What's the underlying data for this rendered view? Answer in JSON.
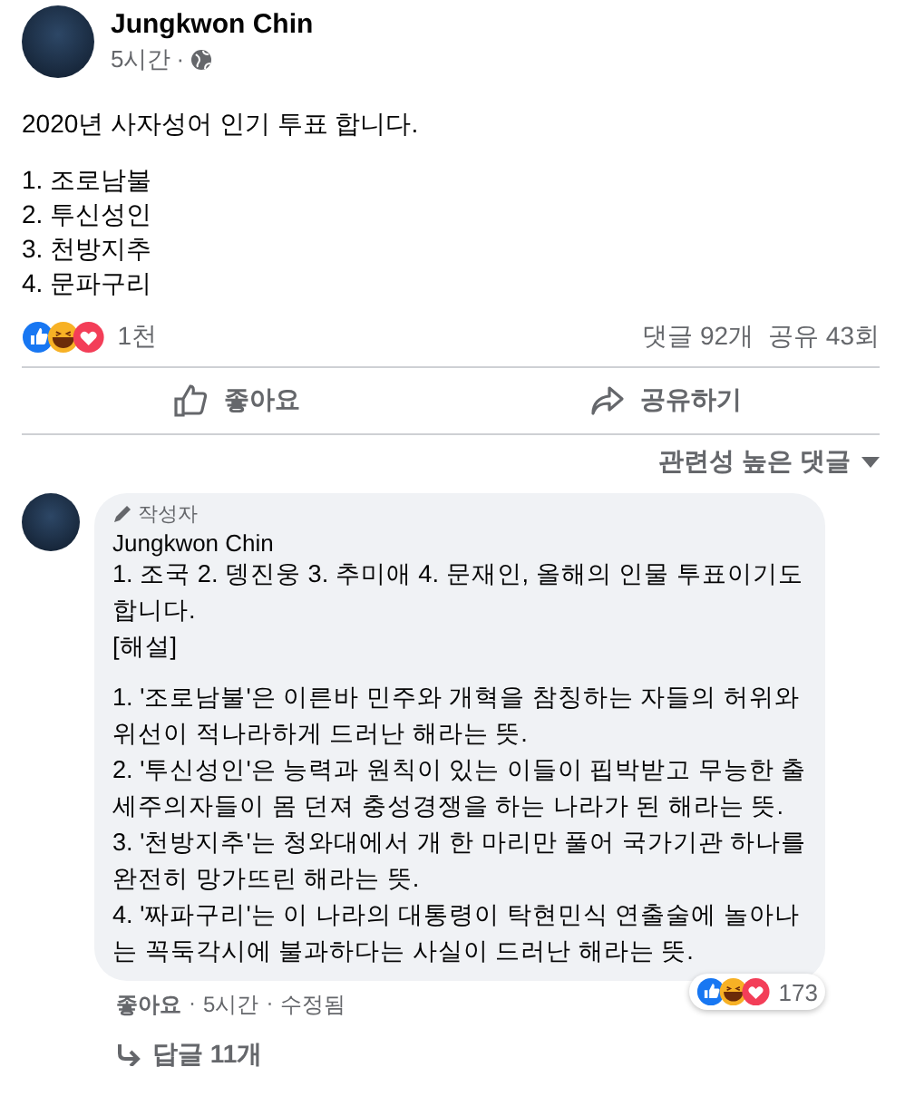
{
  "post": {
    "author": "Jungkwon Chin",
    "time": "5시간",
    "separator": "·",
    "text": "2020년 사자성어 인기 투표 합니다.",
    "items": [
      "1. 조로남불",
      "2. 투신성인",
      "3. 천방지추",
      "4. 문파구리"
    ],
    "reaction_count": "1천",
    "comments": "댓글 92개",
    "shares": "공유 43회",
    "actions": [
      {
        "kind": "like",
        "label": "좋아요"
      },
      {
        "kind": "share",
        "label": "공유하기"
      }
    ],
    "sort": "관련성 높은 댓글"
  },
  "comment": {
    "badge": "작성자",
    "author": "Jungkwon Chin",
    "intro": [
      "1. 조국 2. 뎅진웅 3. 추미애 4. 문재인, 올해의 인물 투표이기도 합니다.",
      "[해설]"
    ],
    "notes": [
      "1. '조로남불'은 이른바 민주와 개혁을 참칭하는 자들의 허위와 위선이 적나라하게 드러난 해라는 뜻.",
      "2. '투신성인'은 능력과 원칙이 있는 이들이 핍박받고 무능한 출세주의자들이 몸 던져 충성경쟁을 하는 나라가 된 해라는 뜻.",
      "3. '천방지추'는 청와대에서 개 한 마리만 풀어 국가기관 하나를 완전히 망가뜨린 해라는 뜻.",
      "4. '짜파구리'는 이 나라의 대통령이 탁현민식 연출술에 놀아나는 꼭둑각시에 불과하다는 사실이 드러난 해라는 뜻."
    ],
    "reaction_count": "173",
    "like": "좋아요",
    "separator": "·",
    "time": "5시간",
    "edited": "수정됨",
    "replies": "답글 11개"
  }
}
